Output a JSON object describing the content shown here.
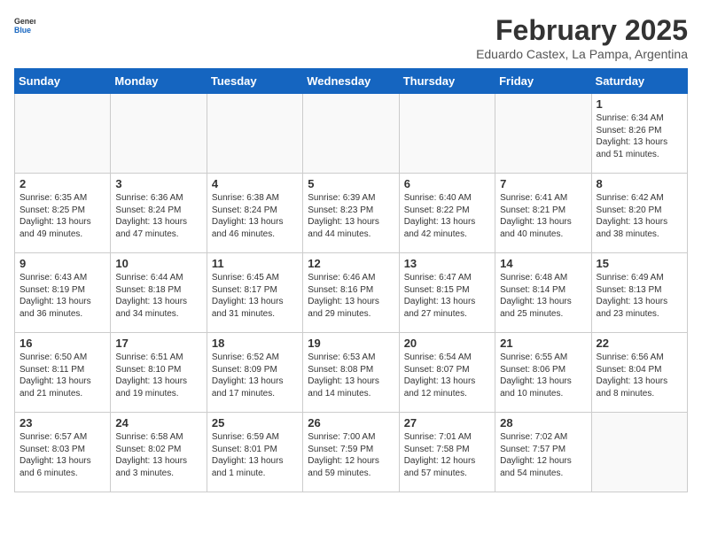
{
  "header": {
    "logo_general": "General",
    "logo_blue": "Blue",
    "title": "February 2025",
    "subtitle": "Eduardo Castex, La Pampa, Argentina"
  },
  "weekdays": [
    "Sunday",
    "Monday",
    "Tuesday",
    "Wednesday",
    "Thursday",
    "Friday",
    "Saturday"
  ],
  "weeks": [
    [
      {
        "day": "",
        "info": ""
      },
      {
        "day": "",
        "info": ""
      },
      {
        "day": "",
        "info": ""
      },
      {
        "day": "",
        "info": ""
      },
      {
        "day": "",
        "info": ""
      },
      {
        "day": "",
        "info": ""
      },
      {
        "day": "1",
        "info": "Sunrise: 6:34 AM\nSunset: 8:26 PM\nDaylight: 13 hours\nand 51 minutes."
      }
    ],
    [
      {
        "day": "2",
        "info": "Sunrise: 6:35 AM\nSunset: 8:25 PM\nDaylight: 13 hours\nand 49 minutes."
      },
      {
        "day": "3",
        "info": "Sunrise: 6:36 AM\nSunset: 8:24 PM\nDaylight: 13 hours\nand 47 minutes."
      },
      {
        "day": "4",
        "info": "Sunrise: 6:38 AM\nSunset: 8:24 PM\nDaylight: 13 hours\nand 46 minutes."
      },
      {
        "day": "5",
        "info": "Sunrise: 6:39 AM\nSunset: 8:23 PM\nDaylight: 13 hours\nand 44 minutes."
      },
      {
        "day": "6",
        "info": "Sunrise: 6:40 AM\nSunset: 8:22 PM\nDaylight: 13 hours\nand 42 minutes."
      },
      {
        "day": "7",
        "info": "Sunrise: 6:41 AM\nSunset: 8:21 PM\nDaylight: 13 hours\nand 40 minutes."
      },
      {
        "day": "8",
        "info": "Sunrise: 6:42 AM\nSunset: 8:20 PM\nDaylight: 13 hours\nand 38 minutes."
      }
    ],
    [
      {
        "day": "9",
        "info": "Sunrise: 6:43 AM\nSunset: 8:19 PM\nDaylight: 13 hours\nand 36 minutes."
      },
      {
        "day": "10",
        "info": "Sunrise: 6:44 AM\nSunset: 8:18 PM\nDaylight: 13 hours\nand 34 minutes."
      },
      {
        "day": "11",
        "info": "Sunrise: 6:45 AM\nSunset: 8:17 PM\nDaylight: 13 hours\nand 31 minutes."
      },
      {
        "day": "12",
        "info": "Sunrise: 6:46 AM\nSunset: 8:16 PM\nDaylight: 13 hours\nand 29 minutes."
      },
      {
        "day": "13",
        "info": "Sunrise: 6:47 AM\nSunset: 8:15 PM\nDaylight: 13 hours\nand 27 minutes."
      },
      {
        "day": "14",
        "info": "Sunrise: 6:48 AM\nSunset: 8:14 PM\nDaylight: 13 hours\nand 25 minutes."
      },
      {
        "day": "15",
        "info": "Sunrise: 6:49 AM\nSunset: 8:13 PM\nDaylight: 13 hours\nand 23 minutes."
      }
    ],
    [
      {
        "day": "16",
        "info": "Sunrise: 6:50 AM\nSunset: 8:11 PM\nDaylight: 13 hours\nand 21 minutes."
      },
      {
        "day": "17",
        "info": "Sunrise: 6:51 AM\nSunset: 8:10 PM\nDaylight: 13 hours\nand 19 minutes."
      },
      {
        "day": "18",
        "info": "Sunrise: 6:52 AM\nSunset: 8:09 PM\nDaylight: 13 hours\nand 17 minutes."
      },
      {
        "day": "19",
        "info": "Sunrise: 6:53 AM\nSunset: 8:08 PM\nDaylight: 13 hours\nand 14 minutes."
      },
      {
        "day": "20",
        "info": "Sunrise: 6:54 AM\nSunset: 8:07 PM\nDaylight: 13 hours\nand 12 minutes."
      },
      {
        "day": "21",
        "info": "Sunrise: 6:55 AM\nSunset: 8:06 PM\nDaylight: 13 hours\nand 10 minutes."
      },
      {
        "day": "22",
        "info": "Sunrise: 6:56 AM\nSunset: 8:04 PM\nDaylight: 13 hours\nand 8 minutes."
      }
    ],
    [
      {
        "day": "23",
        "info": "Sunrise: 6:57 AM\nSunset: 8:03 PM\nDaylight: 13 hours\nand 6 minutes."
      },
      {
        "day": "24",
        "info": "Sunrise: 6:58 AM\nSunset: 8:02 PM\nDaylight: 13 hours\nand 3 minutes."
      },
      {
        "day": "25",
        "info": "Sunrise: 6:59 AM\nSunset: 8:01 PM\nDaylight: 13 hours\nand 1 minute."
      },
      {
        "day": "26",
        "info": "Sunrise: 7:00 AM\nSunset: 7:59 PM\nDaylight: 12 hours\nand 59 minutes."
      },
      {
        "day": "27",
        "info": "Sunrise: 7:01 AM\nSunset: 7:58 PM\nDaylight: 12 hours\nand 57 minutes."
      },
      {
        "day": "28",
        "info": "Sunrise: 7:02 AM\nSunset: 7:57 PM\nDaylight: 12 hours\nand 54 minutes."
      },
      {
        "day": "",
        "info": ""
      }
    ]
  ]
}
